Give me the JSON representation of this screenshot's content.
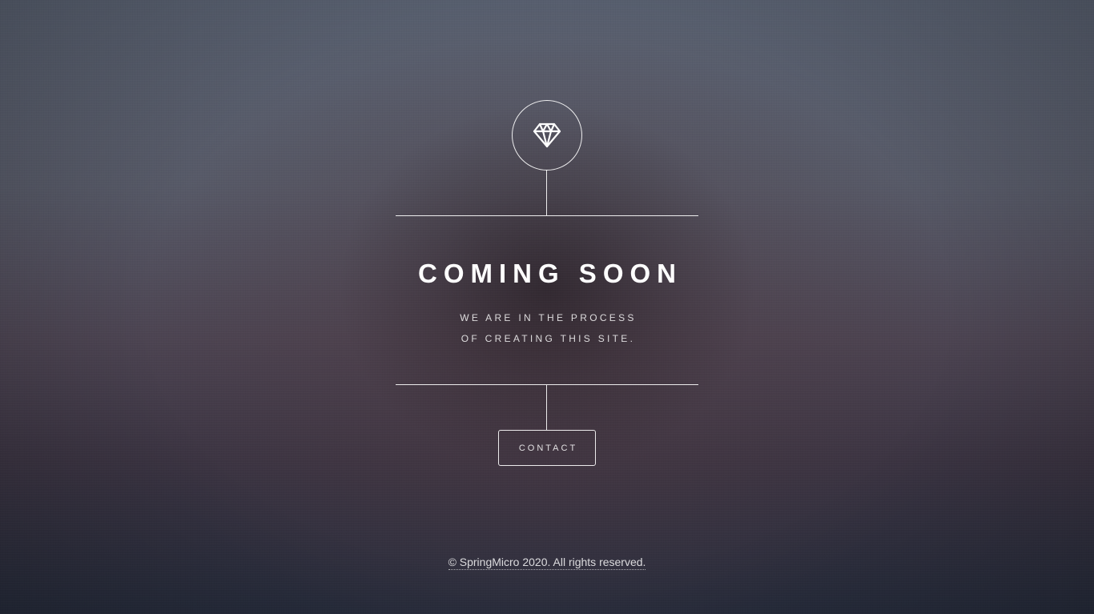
{
  "page": {
    "title": "COMING SOON",
    "subtitle_line1": "WE ARE IN THE PROCESS",
    "subtitle_line2": "OF CREATING THIS SITE.",
    "logo_icon": "diamond-icon"
  },
  "actions": {
    "contact_label": "CONTACT"
  },
  "footer": {
    "copyright": "© SpringMicro 2020. All rights reserved."
  },
  "colors": {
    "text": "#ffffff",
    "background_top": "#5a6272",
    "background_bottom": "#262c3c"
  }
}
